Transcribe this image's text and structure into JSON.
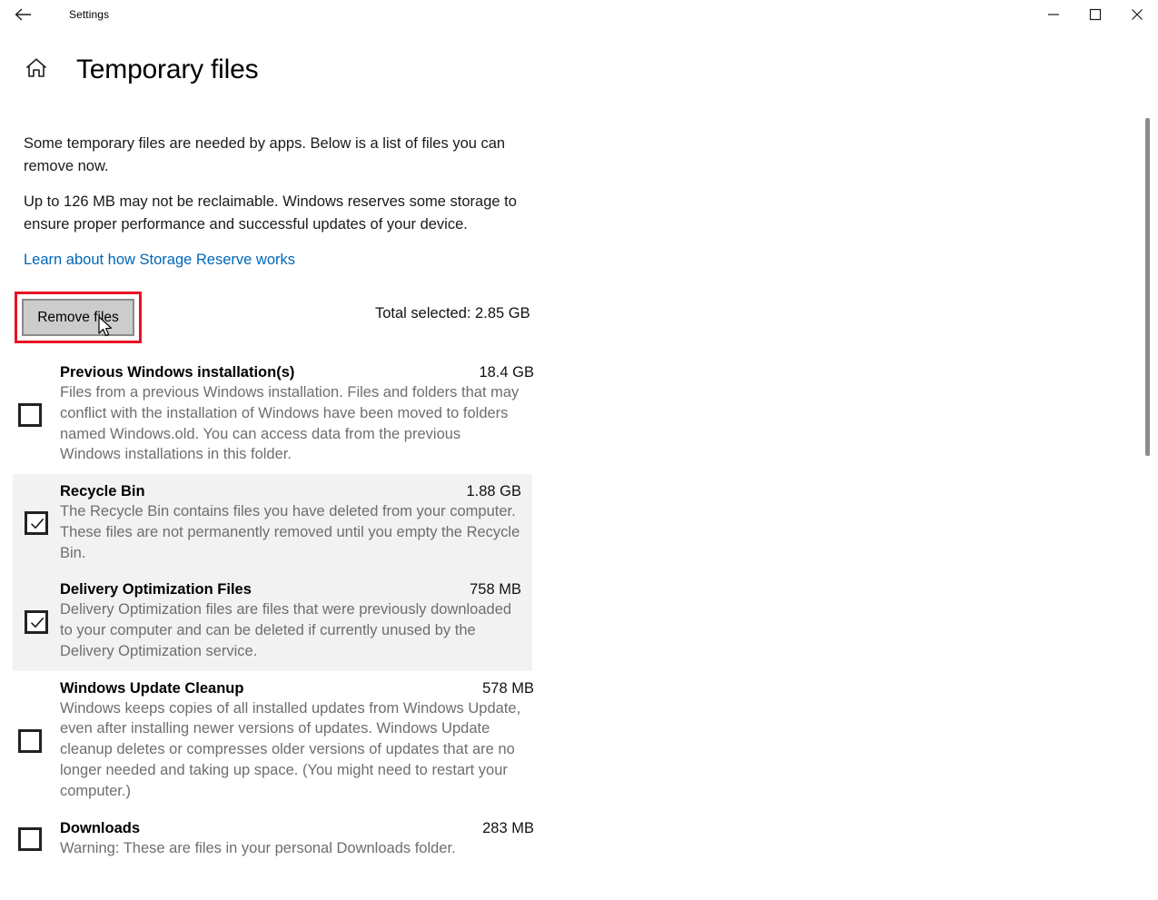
{
  "window": {
    "app_title": "Settings",
    "back_icon": "back-arrow-icon",
    "minimize_label": "—",
    "maximize_label": "□",
    "close_label": "✕"
  },
  "header": {
    "home_icon": "home-icon",
    "page_title": "Temporary files"
  },
  "intro": {
    "paragraph1": "Some temporary files are needed by apps. Below is a list of files you can remove now.",
    "paragraph2": "Up to 126 MB may not be reclaimable. Windows reserves some storage to ensure proper performance and successful updates of your device.",
    "link_text": "Learn about how Storage Reserve works",
    "link_color": "#0067b8"
  },
  "actions": {
    "remove_files_label": "Remove files",
    "total_selected": "Total selected: 2.85 GB",
    "highlight_color": "#e81123"
  },
  "file_items": [
    {
      "name": "Previous Windows installation(s)",
      "size": "18.4 GB",
      "description": "Files from a previous Windows installation.  Files and folders that may conflict with the installation of Windows have been moved to folders named Windows.old.  You can access data from the previous Windows installations in this folder.",
      "checked": false,
      "highlighted": false
    },
    {
      "name": "Recycle Bin",
      "size": "1.88 GB",
      "description": "The Recycle Bin contains files you have deleted from your computer. These files are not permanently removed until you empty the Recycle Bin.",
      "checked": true,
      "highlighted": true
    },
    {
      "name": "Delivery Optimization Files",
      "size": "758 MB",
      "description": "Delivery Optimization files are files that were previously downloaded to your computer and can be deleted if currently unused by the Delivery Optimization service.",
      "checked": true,
      "highlighted": true
    },
    {
      "name": "Windows Update Cleanup",
      "size": "578 MB",
      "description": "Windows keeps copies of all installed updates from Windows Update, even after installing newer versions of updates. Windows Update cleanup deletes or compresses older versions of updates that are no longer needed and taking up space. (You might need to restart your computer.)",
      "checked": false,
      "highlighted": false
    },
    {
      "name": "Downloads",
      "size": "283 MB",
      "description": "Warning: These are files in your personal Downloads folder.",
      "checked": false,
      "highlighted": false
    }
  ],
  "scrollbar": {
    "thumb_color": "#8c8c8c"
  }
}
